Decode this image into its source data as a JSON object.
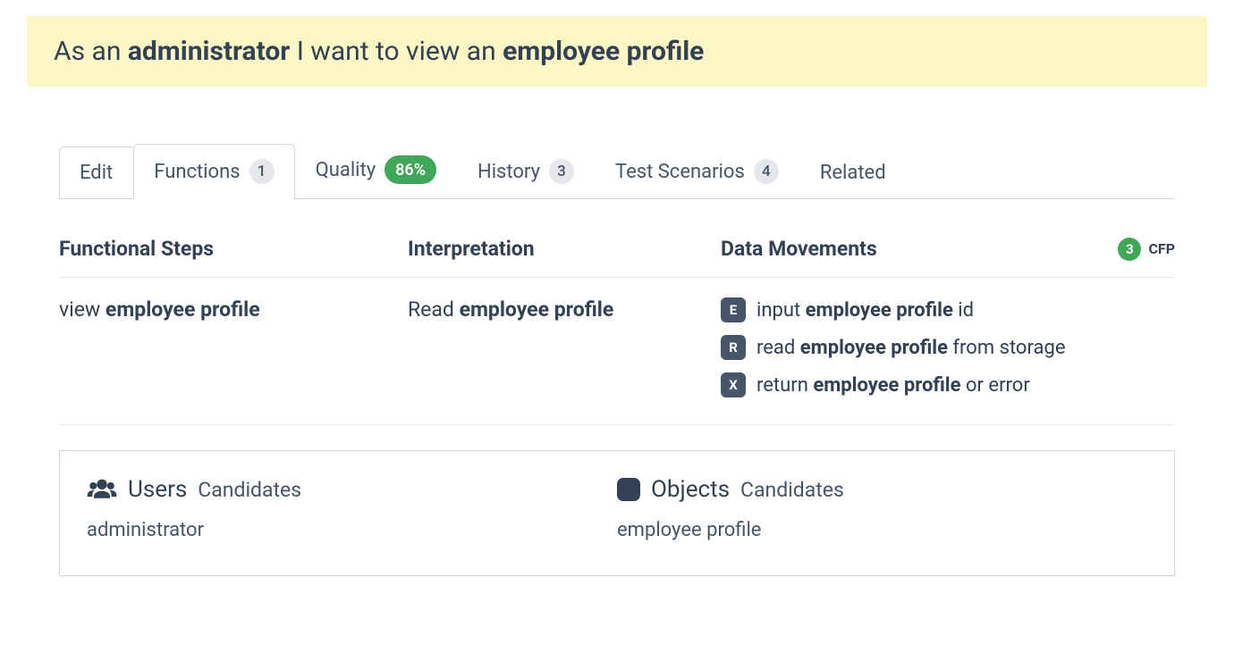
{
  "banner": {
    "pre": "As an ",
    "role": "administrator",
    "mid": " I want to view an ",
    "object": "employee profile"
  },
  "tabs": {
    "edit": "Edit",
    "functions": {
      "label": "Functions",
      "count": "1"
    },
    "quality": {
      "label": "Quality",
      "pct": "86%"
    },
    "history": {
      "label": "History",
      "count": "3"
    },
    "test_scenarios": {
      "label": "Test Scenarios",
      "count": "4"
    },
    "related": "Related"
  },
  "headers": {
    "functional_steps": "Functional Steps",
    "interpretation": "Interpretation",
    "data_movements": "Data Movements",
    "cfp": {
      "count": "3",
      "label": "CFP"
    }
  },
  "row": {
    "step": {
      "pre": "view ",
      "bold": "employee profile"
    },
    "interpretation": {
      "pre": "Read ",
      "bold": "employee profile"
    },
    "movements": [
      {
        "chip": "E",
        "pre": "input ",
        "bold": "employee profile",
        "post": " id"
      },
      {
        "chip": "R",
        "pre": "read ",
        "bold": "employee profile",
        "post": " from storage"
      },
      {
        "chip": "X",
        "pre": "return ",
        "bold": "employee profile",
        "post": " or error"
      }
    ]
  },
  "candidates": {
    "users": {
      "title": "Users",
      "sub": "Candidates",
      "value": "administrator"
    },
    "objects": {
      "title": "Objects",
      "sub": "Candidates",
      "value": "employee profile"
    }
  }
}
